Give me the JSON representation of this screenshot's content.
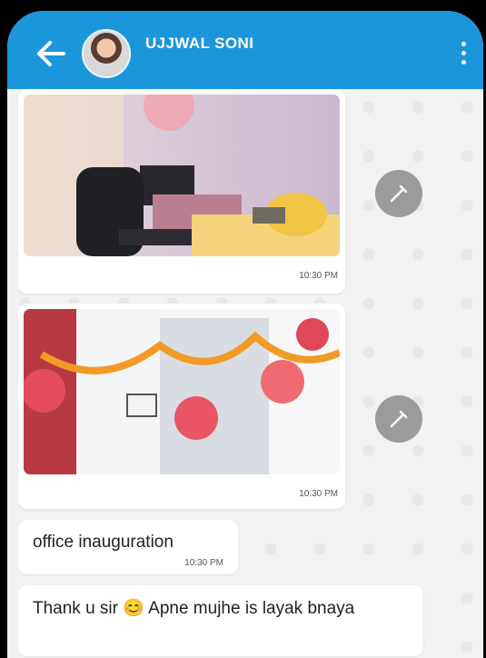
{
  "header": {
    "title": "UJJWAL SONI"
  },
  "messages": [
    {
      "time": "10:30 PM"
    },
    {
      "time": "10:30 PM"
    },
    {
      "text": "office inauguration",
      "time": "10:30 PM"
    },
    {
      "text": "Thank u sir 😊 Apne mujhe is layak bnaya"
    }
  ],
  "icons": [
    "back-arrow-icon",
    "more-vert-icon",
    "share-brush-icon",
    "share-brush-icon"
  ],
  "colors": {
    "header": "#1c96db",
    "background": "#f3f3f3",
    "bubble": "#ffffff",
    "share_button": "#9b9b9b"
  }
}
